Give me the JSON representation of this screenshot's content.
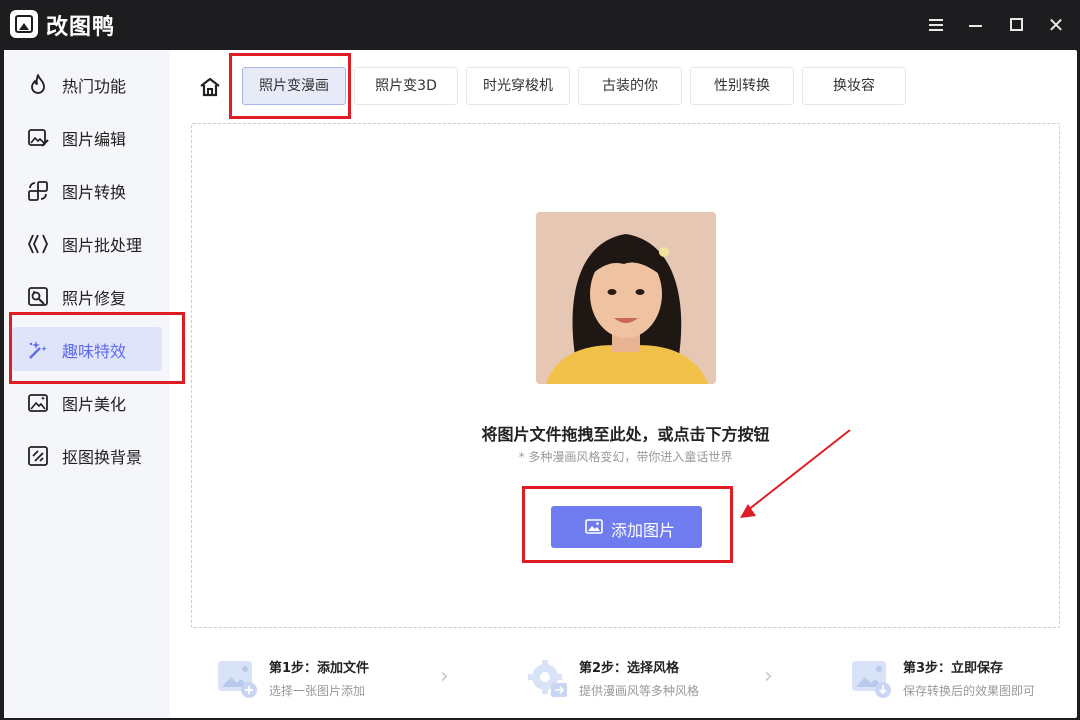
{
  "app": {
    "title": "改图鸭"
  },
  "sidebar": {
    "items": [
      {
        "label": "热门功能",
        "icon": "flame-icon"
      },
      {
        "label": "图片编辑",
        "icon": "image-edit-icon"
      },
      {
        "label": "图片转换",
        "icon": "convert-icon"
      },
      {
        "label": "图片批处理",
        "icon": "batch-icon"
      },
      {
        "label": "照片修复",
        "icon": "photo-repair-icon"
      },
      {
        "label": "趣味特效",
        "icon": "magic-wand-icon",
        "active": true
      },
      {
        "label": "图片美化",
        "icon": "beautify-icon"
      },
      {
        "label": "抠图换背景",
        "icon": "cutout-icon"
      }
    ]
  },
  "tabs": [
    {
      "label": "照片变漫画",
      "active": true
    },
    {
      "label": "照片变3D"
    },
    {
      "label": "时光穿梭机"
    },
    {
      "label": "古装的你"
    },
    {
      "label": "性别转换"
    },
    {
      "label": "换妆容"
    }
  ],
  "dropzone": {
    "title": "将图片文件拖拽至此处，或点击下方按钮",
    "subtitle": "* 多种漫画风格变幻，带你进入童话世界",
    "button_label": "添加图片"
  },
  "steps": [
    {
      "title": "第1步：添加文件",
      "desc": "选择一张图片添加"
    },
    {
      "title": "第2步：选择风格",
      "desc": "提供漫画风等多种风格"
    },
    {
      "title": "第3步：立即保存",
      "desc": "保存转换后的效果图即可"
    }
  ],
  "colors": {
    "accent": "#6f7cf0",
    "annotation": "#e01c24",
    "active_bg": "#dfe4fb"
  }
}
